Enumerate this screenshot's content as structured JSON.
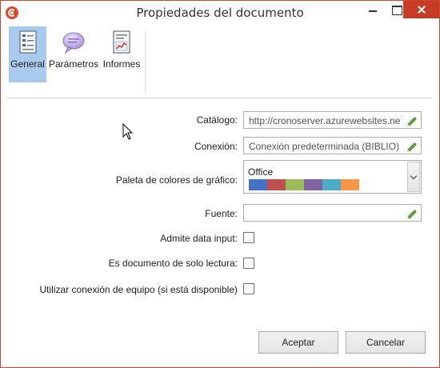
{
  "window": {
    "title": "Propiedades del documento"
  },
  "toolbar": {
    "items": [
      {
        "label": "General",
        "icon": "document-properties-icon",
        "active": true
      },
      {
        "label": "Parámetros",
        "icon": "speech-bubble-icon",
        "active": false
      },
      {
        "label": "Informes",
        "icon": "report-chart-icon",
        "active": false
      }
    ]
  },
  "form": {
    "catalog": {
      "label": "Catálogo:",
      "value": "http://cronoserver.azurewebsites.net"
    },
    "connection": {
      "label": "Conexión:",
      "value": "Conexión predeterminada (BIBLIO)"
    },
    "palette": {
      "label": "Paleta de colores de gráfico:",
      "selected": "Office",
      "colors": [
        "#4472c4",
        "#c0504d",
        "#9bbb59",
        "#8064a2",
        "#4bacc6",
        "#f79646"
      ]
    },
    "font": {
      "label": "Fuente:",
      "value": ""
    },
    "data_input": {
      "label": "Admite data input:",
      "checked": false
    },
    "read_only": {
      "label": "Es documento de solo lectura:",
      "checked": false
    },
    "team_connection": {
      "label": "Utilizar conexión de equipo (si está disponible)",
      "checked": false
    }
  },
  "buttons": {
    "ok": "Aceptar",
    "cancel": "Cancelar"
  }
}
